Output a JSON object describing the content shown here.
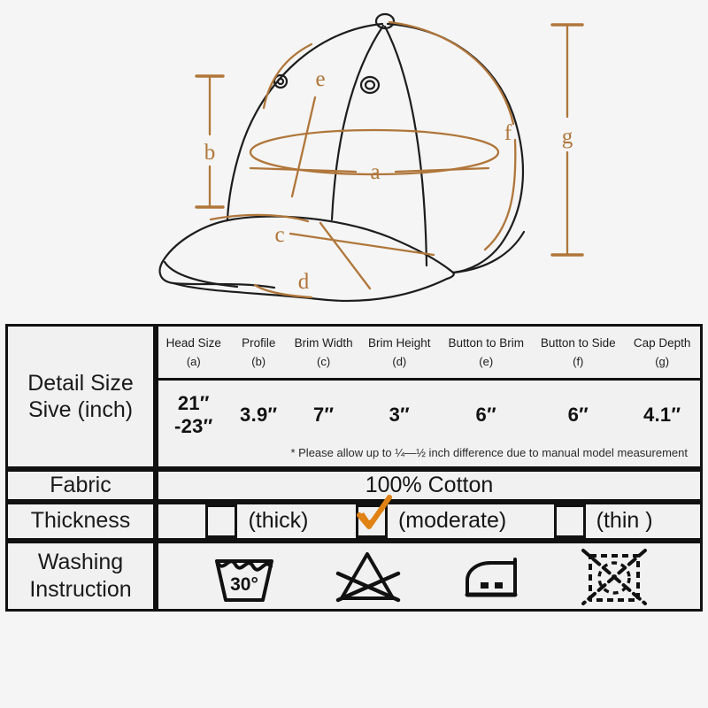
{
  "diagram": {
    "title": "baseball-cap-measurement-diagram",
    "accent_color": "#b0763a",
    "outline_color": "#1d1d1d",
    "background_color": "#f5f5f5",
    "markers": {
      "a": "a",
      "b": "b",
      "c": "c",
      "d": "d",
      "e": "e",
      "f": "f",
      "g": "g"
    }
  },
  "table": {
    "detail": {
      "label_line1": "Detail Size",
      "label_line2": "Sive (inch)",
      "columns": [
        {
          "name": "Head Size",
          "key": "(a)",
          "value": "21″ -23″"
        },
        {
          "name": "Profile",
          "key": "(b)",
          "value": "3.9″"
        },
        {
          "name": "Brim Width",
          "key": "(c)",
          "value": "7″"
        },
        {
          "name": "Brim Height",
          "key": "(d)",
          "value": "3″"
        },
        {
          "name": "Button to Brim",
          "key": "(e)",
          "value": "6″"
        },
        {
          "name": "Button to Side",
          "key": "(f)",
          "value": "6″"
        },
        {
          "name": "Cap Depth",
          "key": "(g)",
          "value": "4.1″"
        }
      ],
      "note": "* Please allow up to ¼—½ inch difference due to manual model measurement"
    },
    "fabric": {
      "label": "Fabric",
      "value": "100% Cotton"
    },
    "thickness": {
      "label": "Thickness",
      "checked_color": "#e08214",
      "options": [
        {
          "label": "(thick)",
          "checked": false
        },
        {
          "label": "(moderate)",
          "checked": true
        },
        {
          "label": "(thin )",
          "checked": false
        }
      ]
    },
    "washing": {
      "label_line1": "Washing",
      "label_line2": "Instruction",
      "icons": [
        {
          "name": "wash-30-degrees-icon",
          "text": "30°"
        },
        {
          "name": "do-not-bleach-icon",
          "text": ""
        },
        {
          "name": "iron-medium-icon",
          "text": ""
        },
        {
          "name": "do-not-tumble-dry-icon",
          "text": ""
        }
      ]
    }
  }
}
